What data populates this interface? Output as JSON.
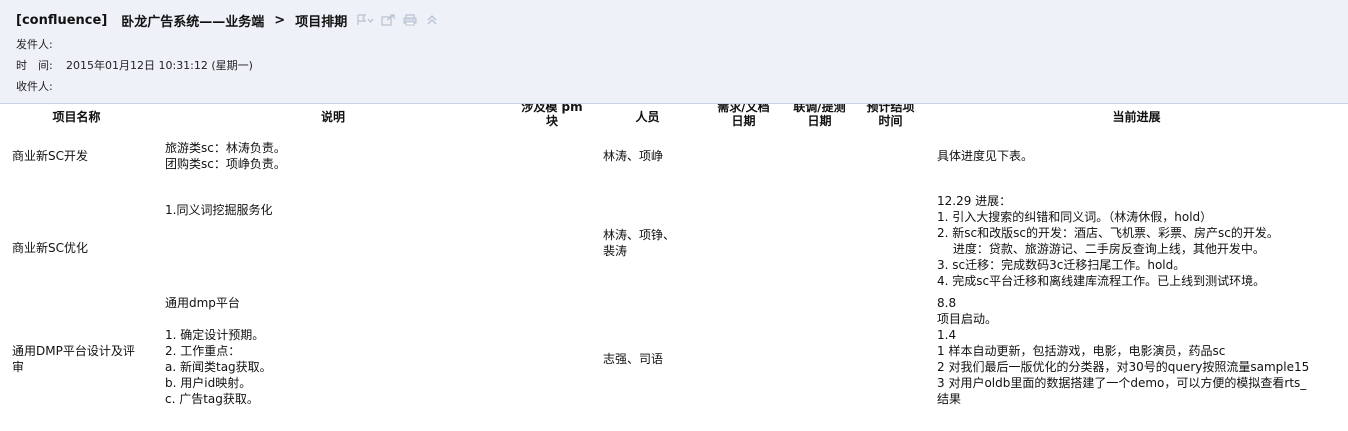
{
  "email": {
    "subject_tag": "[confluence]",
    "subject_space": "卧龙广告系统——业务端",
    "subject_sep": ">",
    "subject_page": "项目排期",
    "toolbar": [
      "flag-icon",
      "popout-icon",
      "print-icon",
      "collapse-icon"
    ],
    "from_label": "发件人:",
    "from_value": "",
    "time_label": "时　间:",
    "time_value": "2015年01月12日 10:31:12 (星期一)",
    "to_label": "收件人:",
    "to_value": ""
  },
  "table": {
    "headers": [
      {
        "line1": "项目名称",
        "line2": ""
      },
      {
        "line1": "说明",
        "line2": ""
      },
      {
        "line1": "涉及模  pm",
        "line2": "块"
      },
      {
        "line1": "人员",
        "line2": ""
      },
      {
        "line1": "需求/文档",
        "line2": "日期"
      },
      {
        "line1": "联调/提测",
        "line2": "日期"
      },
      {
        "line1": "预计结项",
        "line2": "时间"
      },
      {
        "line1": "当前进展",
        "line2": ""
      }
    ],
    "rows": [
      {
        "name": "商业新SC开发",
        "desc": [
          "旅游类sc：林涛负责。",
          "团购类sc：项峥负责。"
        ],
        "people": [
          "林涛、项峥"
        ],
        "progress": [
          "具体进度见下表。"
        ]
      },
      {
        "name": "商业新SC优化",
        "desc": [
          "1.同义词挖掘服务化"
        ],
        "people": [
          "林涛、项铮、",
          "裴涛"
        ],
        "progress": [
          "12.29 进展：",
          "1. 引入大搜索的纠错和同义词。（林涛休假，hold）",
          "2. 新sc和改版sc的开发：酒店、飞机票、彩票、房产sc的开发。",
          "　 进度：贷款、旅游游记、二手房反查询上线，其他开发中。",
          "3. sc迁移：完成数码3c迁移扫尾工作。hold。",
          "4. 完成sc平台迁移和离线建库流程工作。已上线到测试环境。"
        ]
      },
      {
        "name_lines": [
          "通用DMP平台设计及评",
          "审"
        ],
        "desc": [
          "通用dmp平台",
          "",
          "1. 确定设计预期。",
          "2. 工作重点：",
          "a. 新闻类tag获取。",
          "b. 用户id映射。",
          "c. 广告tag获取。"
        ],
        "people": [
          "志强、司语"
        ],
        "progress": [
          "8.8",
          "项目启动。",
          "1.4",
          "1 样本自动更新，包括游戏，电影，电影演员，药品sc",
          "2 对我们最后一版优化的分类器，对30号的query按照流量sample15",
          "3 对用户oldb里面的数据搭建了一个demo，可以方便的模拟查看rts_",
          "结果"
        ]
      }
    ]
  }
}
